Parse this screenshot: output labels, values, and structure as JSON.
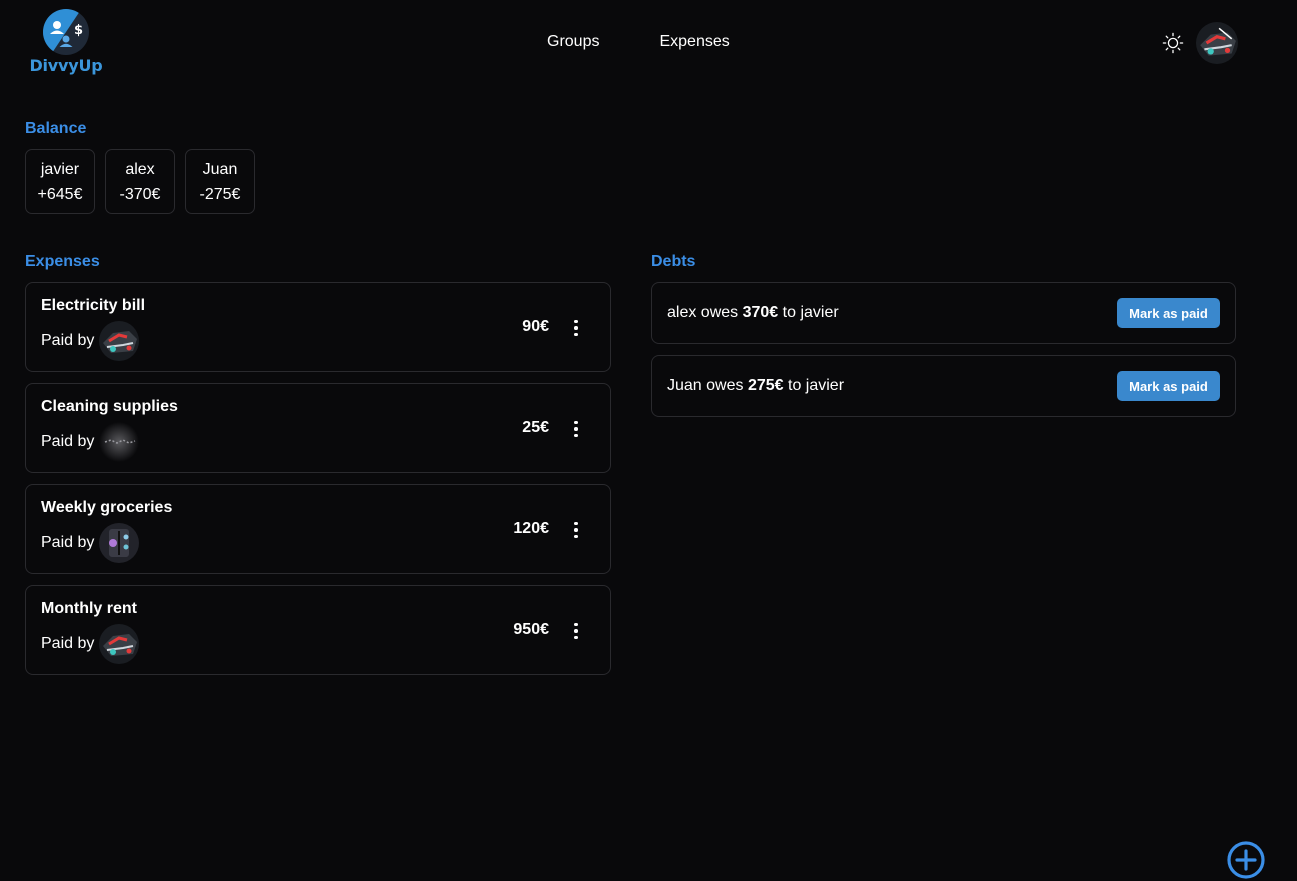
{
  "app": {
    "name": "DivvyUp"
  },
  "nav": {
    "groups": "Groups",
    "expenses": "Expenses"
  },
  "icons": {
    "logo": "divvyup-logo-icon",
    "theme": "sun-icon",
    "fab": "plus-circle-icon",
    "menu": "kebab-menu-icon"
  },
  "colors": {
    "accent": "#3b8ee6",
    "button": "#3a88cd",
    "background": "#09090b"
  },
  "balance": {
    "title": "Balance",
    "items": [
      {
        "name": "javier",
        "amount": "+645€"
      },
      {
        "name": "alex",
        "amount": "-370€"
      },
      {
        "name": "Juan",
        "amount": "-275€"
      }
    ]
  },
  "expenses": {
    "title": "Expenses",
    "paid_by_label": "Paid by",
    "items": [
      {
        "name": "Electricity bill",
        "amount": "90€"
      },
      {
        "name": "Cleaning supplies",
        "amount": "25€"
      },
      {
        "name": "Weekly groceries",
        "amount": "120€"
      },
      {
        "name": "Monthly rent",
        "amount": "950€"
      }
    ]
  },
  "debts": {
    "title": "Debts",
    "button_label": "Mark as paid",
    "items": [
      {
        "debtor": "alex",
        "owes": " owes ",
        "amount": "370€",
        "to": " to ",
        "creditor": "javier"
      },
      {
        "debtor": "Juan",
        "owes": " owes ",
        "amount": "275€",
        "to": " to ",
        "creditor": "javier"
      }
    ]
  }
}
